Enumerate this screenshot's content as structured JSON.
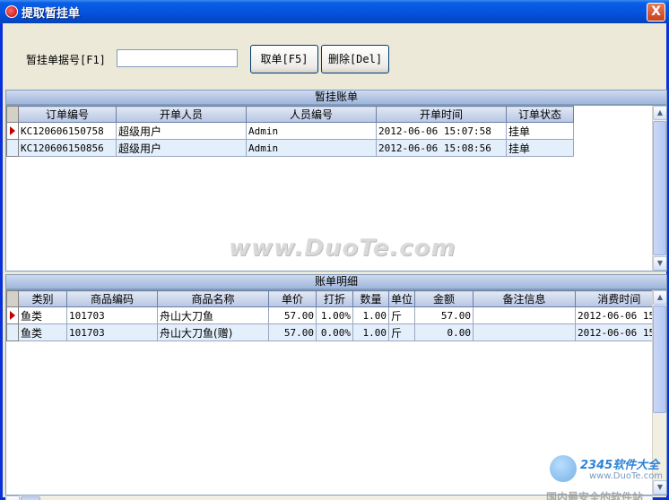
{
  "window": {
    "title": "提取暂挂单",
    "close_label": "X"
  },
  "form": {
    "bill_label": "暂挂单据号[F1]",
    "bill_value": "",
    "take_button": "取单[F5]",
    "delete_button": "删除[Del]"
  },
  "orders": {
    "section_title": "暂挂账单",
    "columns": [
      "订单编号",
      "开单人员",
      "人员编号",
      "开单时间",
      "订单状态"
    ],
    "rows": [
      [
        "KC120606150758",
        "超级用户",
        "Admin",
        "2012-06-06 15:07:58",
        "挂单"
      ],
      [
        "KC120606150856",
        "超级用户",
        "Admin",
        "2012-06-06 15:08:56",
        "挂单"
      ]
    ]
  },
  "details": {
    "section_title": "账单明细",
    "columns": [
      "类别",
      "商品编码",
      "商品名称",
      "单价",
      "打折",
      "数量",
      "单位",
      "金额",
      "备注信息",
      "消费时间"
    ],
    "rows": [
      [
        "鱼类",
        "101703",
        "舟山大刀鱼",
        "57.00",
        "1.00%",
        "1.00",
        "斤",
        "57.00",
        "",
        "2012-06-06 15:"
      ],
      [
        "鱼类",
        "101703",
        "舟山大刀鱼(赠)",
        "57.00",
        "0.00%",
        "1.00",
        "斤",
        "0.00",
        "",
        "2012-06-06 15:"
      ]
    ]
  },
  "watermarks": {
    "main": "www.DuoTe.com",
    "brand": "2345软件大全",
    "url": "www.DuoTe.com",
    "tagline": "国内最安全的软件站"
  },
  "colors": {
    "titlebar": "#0554e0",
    "selected_row_marker": "#c00000",
    "alt_row": "#e4effc"
  }
}
